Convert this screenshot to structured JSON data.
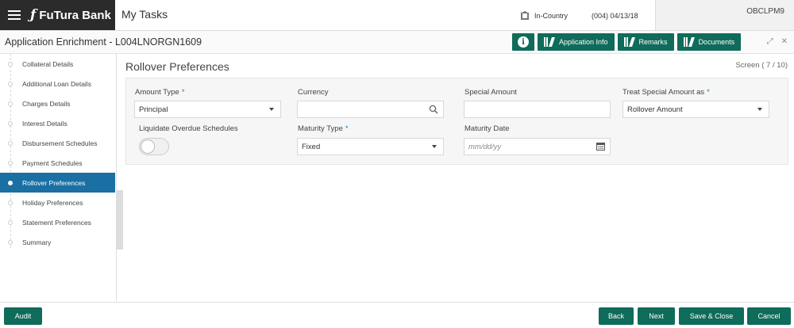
{
  "header": {
    "brand": "FuTura Bank",
    "title": "My Tasks",
    "region": "In-Country",
    "branch_date": "(004)  04/13/18",
    "user": "OBCLPM9"
  },
  "subheader": {
    "title": "Application Enrichment - L004LNORGN1609",
    "buttons": {
      "app_info": "Application Info",
      "remarks": "Remarks",
      "documents": "Documents"
    }
  },
  "sidebar": {
    "items": [
      {
        "label": "Collateral Details"
      },
      {
        "label": "Additional Loan Details"
      },
      {
        "label": "Charges Details"
      },
      {
        "label": "Interest Details"
      },
      {
        "label": "Disbursement Schedules"
      },
      {
        "label": "Payment Schedules"
      },
      {
        "label": "Rollover Preferences"
      },
      {
        "label": "Holiday Preferences"
      },
      {
        "label": "Statement Preferences"
      },
      {
        "label": "Summary"
      }
    ],
    "active_index": 6
  },
  "main": {
    "section_title": "Rollover Preferences",
    "screen_count": "Screen ( 7 / 10)",
    "fields": {
      "amount_type": {
        "label": "Amount Type",
        "value": "Principal"
      },
      "currency": {
        "label": "Currency",
        "value": ""
      },
      "special_amount": {
        "label": "Special Amount",
        "value": ""
      },
      "treat_special": {
        "label": "Treat Special Amount as",
        "value": "Rollover Amount"
      },
      "liquidate": {
        "label": "Liquidate Overdue Schedules"
      },
      "maturity_type": {
        "label": "Maturity Type",
        "value": "Fixed"
      },
      "maturity_date": {
        "label": "Maturity Date",
        "placeholder": "mm/dd/yy"
      }
    }
  },
  "footer": {
    "audit": "Audit",
    "back": "Back",
    "next": "Next",
    "save_close": "Save & Close",
    "cancel": "Cancel"
  },
  "colors": {
    "brand_dark": "#2b2b2b",
    "button_green": "#0f6b5a",
    "active_blue": "#1a6fa3"
  }
}
